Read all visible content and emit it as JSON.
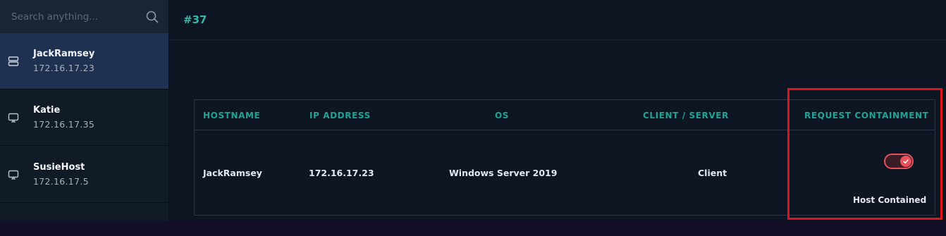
{
  "search": {
    "placeholder": "Search anything..."
  },
  "sidebar": {
    "items": [
      {
        "name": "JackRamsey",
        "ip": "172.16.17.23",
        "icon": "server-icon"
      },
      {
        "name": "Katie",
        "ip": "172.16.17.35",
        "icon": "monitor-icon"
      },
      {
        "name": "SusieHost",
        "ip": "172.16.17.5",
        "icon": "monitor-icon"
      }
    ]
  },
  "header": {
    "id": "#37"
  },
  "table": {
    "columns": [
      "HOSTNAME",
      "IP ADDRESS",
      "OS",
      "CLIENT / SERVER",
      "REQUEST CONTAINMENT"
    ],
    "row": {
      "hostname": "JackRamsey",
      "ip": "172.16.17.23",
      "os": "Windows Server 2019",
      "role": "Client",
      "containment_status": "Host Contained"
    }
  },
  "colors": {
    "accent": "#1fa394",
    "toggle_on": "#e8505b",
    "highlight": "#e0141e",
    "active_item": "#1f3150"
  }
}
